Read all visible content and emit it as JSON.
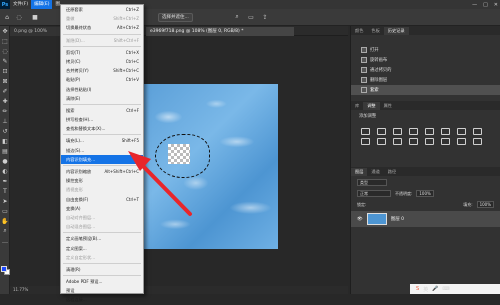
{
  "app": {
    "logo": "Ps"
  },
  "menubar": {
    "items": [
      {
        "label": "文件(F)"
      },
      {
        "label": "编辑(E)"
      },
      {
        "label": "图"
      }
    ]
  },
  "window_controls": {
    "minimize": "—",
    "maximize": "□",
    "close": "✕"
  },
  "options_bar": {
    "select_subject": "选择并遮住..."
  },
  "tabs": [
    {
      "label": "0.png @ 100%"
    },
    {
      "label": "e3969f718.png @ 108% (图层 0, RGB/8) *"
    }
  ],
  "edit_menu": {
    "items": [
      {
        "label": "还原套索",
        "shortcut": "Ctrl+Z",
        "disabled": false
      },
      {
        "label": "重做",
        "shortcut": "Shift+Ctrl+Z",
        "disabled": true
      },
      {
        "label": "切换最终状态",
        "shortcut": "Alt+Ctrl+Z",
        "disabled": false
      },
      {
        "sep": true
      },
      {
        "label": "渐隐(D)...",
        "shortcut": "Shift+Ctrl+F",
        "disabled": true
      },
      {
        "sep": true
      },
      {
        "label": "剪切(T)",
        "shortcut": "Ctrl+X",
        "disabled": false
      },
      {
        "label": "拷贝(C)",
        "shortcut": "Ctrl+C",
        "disabled": false
      },
      {
        "label": "合并拷贝(Y)",
        "shortcut": "Shift+Ctrl+C",
        "disabled": false
      },
      {
        "label": "粘贴(P)",
        "shortcut": "Ctrl+V",
        "disabled": false
      },
      {
        "label": "选择性粘贴(I)",
        "shortcut": "",
        "disabled": false
      },
      {
        "label": "清除(E)",
        "shortcut": "",
        "disabled": false
      },
      {
        "sep": true
      },
      {
        "label": "搜索",
        "shortcut": "Ctrl+F",
        "disabled": false
      },
      {
        "label": "拼写检查(H)...",
        "shortcut": "",
        "disabled": false
      },
      {
        "label": "查找和替换文本(X)...",
        "shortcut": "",
        "disabled": false
      },
      {
        "sep": true
      },
      {
        "label": "填充(L)...",
        "shortcut": "Shift+F5",
        "disabled": false
      },
      {
        "label": "描边(S)...",
        "shortcut": "",
        "disabled": false
      },
      {
        "label": "内容识别填充...",
        "shortcut": "",
        "disabled": false,
        "highlight": true
      },
      {
        "sep": true
      },
      {
        "label": "内容识别缩放",
        "shortcut": "Alt+Shift+Ctrl+C",
        "disabled": false
      },
      {
        "label": "操控变形",
        "shortcut": "",
        "disabled": false
      },
      {
        "label": "透视变形",
        "shortcut": "",
        "disabled": true
      },
      {
        "label": "自由变换(F)",
        "shortcut": "Ctrl+T",
        "disabled": false
      },
      {
        "label": "变换(A)",
        "shortcut": "",
        "disabled": false
      },
      {
        "label": "自动对齐图层...",
        "shortcut": "",
        "disabled": true
      },
      {
        "label": "自动混合图层...",
        "shortcut": "",
        "disabled": true
      },
      {
        "sep": true
      },
      {
        "label": "定义画笔预设(B)...",
        "shortcut": "",
        "disabled": false
      },
      {
        "label": "定义图案...",
        "shortcut": "",
        "disabled": false
      },
      {
        "label": "定义自定形状...",
        "shortcut": "",
        "disabled": true
      },
      {
        "sep": true
      },
      {
        "label": "清理(R)",
        "shortcut": "",
        "disabled": false
      },
      {
        "sep": true
      },
      {
        "label": "Adobe PDF 预设...",
        "shortcut": "",
        "disabled": false
      },
      {
        "label": "预设",
        "shortcut": "",
        "disabled": false
      },
      {
        "label": "远程连接...",
        "shortcut": "",
        "disabled": false
      }
    ]
  },
  "status": {
    "zoom": "11.77%"
  },
  "right_panel": {
    "tabs": [
      "颜色",
      "色板",
      "历史记录"
    ],
    "history": [
      {
        "label": "打开",
        "selected": false
      },
      {
        "label": "旋转画布",
        "selected": false
      },
      {
        "label": "通过拷贝的",
        "selected": false
      },
      {
        "label": "删除图层",
        "selected": false
      },
      {
        "label": "套索",
        "selected": true
      }
    ],
    "adjust_tabs": [
      "库",
      "调整",
      "属性"
    ],
    "adjust_title": "添加调整",
    "layer_tabs": [
      "图层",
      "通道",
      "路径"
    ],
    "layer_filter": "类型",
    "blend_mode": "正常",
    "opacity_label": "不透明度:",
    "opacity_value": "100%",
    "lock_label": "锁定:",
    "fill_label": "填充:",
    "fill_value": "100%",
    "layer_name": "图层 0"
  },
  "taskbar": {
    "lang": "英"
  }
}
